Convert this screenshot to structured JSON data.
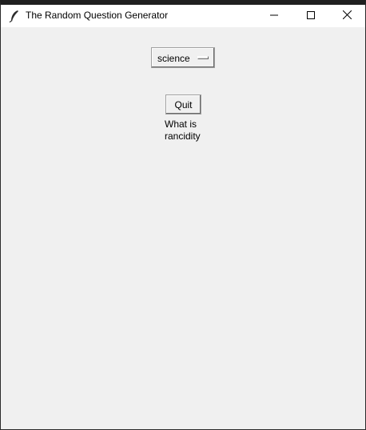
{
  "window": {
    "title": "The Random Question Generator",
    "controls": {
      "minimize_icon": "minimize-icon",
      "maximize_icon": "maximize-icon",
      "close_icon": "close-icon"
    },
    "app_icon": "feather-icon"
  },
  "main": {
    "category_menu": {
      "selected": "science"
    },
    "quit_label": "Quit",
    "question_text": "What is rancidity"
  },
  "colors": {
    "background": "#f0f0f0",
    "titlebar": "#ffffff",
    "text": "#000000"
  }
}
